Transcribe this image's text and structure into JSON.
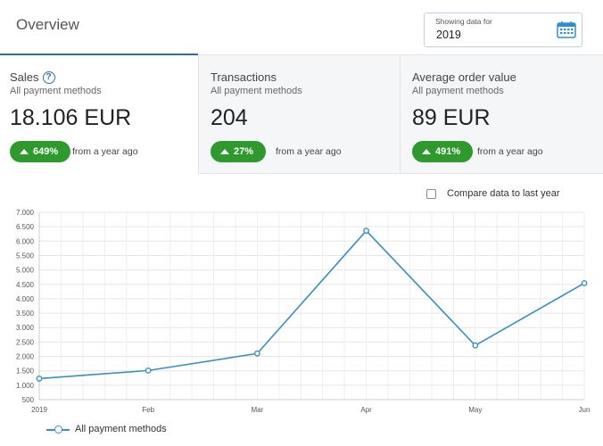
{
  "header": {
    "title": "Overview",
    "date_picker": {
      "caption": "Showing data for",
      "value": "2019",
      "icon": "calendar-icon"
    }
  },
  "stats": [
    {
      "title": "Sales",
      "has_help": true,
      "subtitle": "All payment methods",
      "value": "18.106 EUR",
      "change": "649%",
      "change_note": "from a year ago"
    },
    {
      "title": "Transactions",
      "subtitle": "All payment methods",
      "value": "204",
      "change": "27%",
      "change_note": "from a year ago"
    },
    {
      "title": "Average order value",
      "subtitle": "All payment methods",
      "value": "89 EUR",
      "change": "491%",
      "change_note": "from a year ago"
    }
  ],
  "compare": {
    "label": "Compare data to last year",
    "checked": false
  },
  "colors": {
    "accent": "#2e6dad",
    "positive": "#2e9a2e",
    "series": "#3b8fc0"
  },
  "chart_data": {
    "type": "line",
    "categories": [
      "2019",
      "Feb",
      "Mar",
      "Apr",
      "May",
      "Jun"
    ],
    "series": [
      {
        "name": "All payment methods",
        "values": [
          1230,
          1510,
          2100,
          6360,
          2380,
          4540
        ]
      }
    ],
    "ylim": [
      500,
      7000
    ],
    "yticks": [
      "500",
      "1.000",
      "1.500",
      "2.000",
      "2.500",
      "3.000",
      "3.500",
      "4.000",
      "4.500",
      "5.000",
      "5.500",
      "6.000",
      "6.500",
      "7.000"
    ],
    "grid": true,
    "legend": "bottom-left"
  }
}
